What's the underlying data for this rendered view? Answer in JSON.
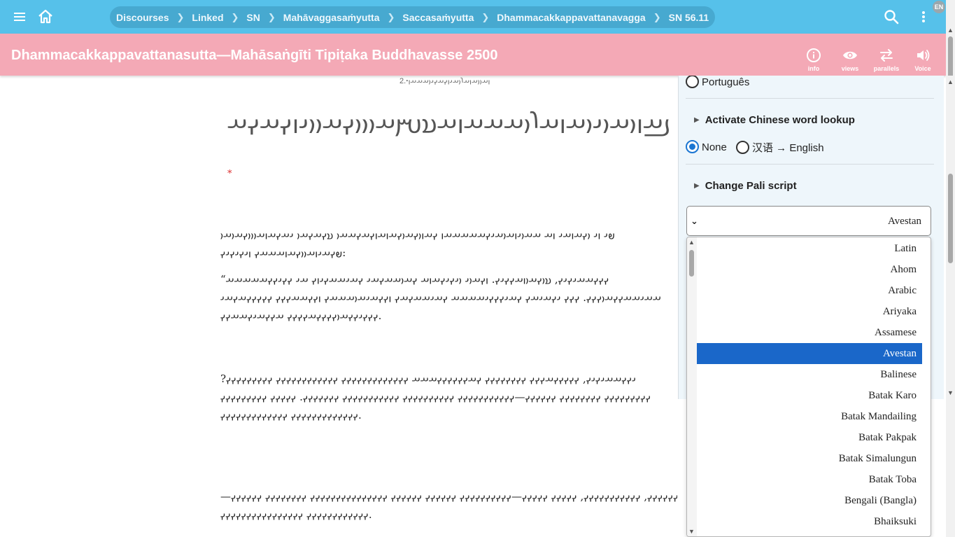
{
  "topbar": {
    "breadcrumbs": [
      "Discourses",
      "Linked",
      "SN",
      "Mahāvaggasaṁyutta",
      "Saccasaṁyutta",
      "Dhammacakkappavattanavagga",
      "SN 56.11"
    ],
    "lang_badge": "EN"
  },
  "titlebar": {
    "title": "Dhammacakkappavattanasutta—Mahāsaṅgīti Tipiṭaka Buddhavasse 2500",
    "buttons": [
      {
        "label": "info",
        "icon": "info-icon"
      },
      {
        "label": "views",
        "icon": "eye-icon"
      },
      {
        "label": "parallels",
        "icon": "parallels-icon"
      },
      {
        "label": "Voice",
        "icon": "speaker-icon"
      }
    ]
  },
  "content": {
    "top_line": "2.ꞏ𐬥𐬀𐬎𐬎𐬀𐬥𐬀𐬭𐬎𐬀𐬌𐬥𐬍𐬀𐬍𐬌𐬎𐬀𐬀𐬀𐬥",
    "heading": "𐬠𐬀𐬥𐬎𐬀𐬎𐬌𐬎𐬀𐬥𐬀𐬭𐬎𐬀𐬀𐬀𐬥𐬀𐬯𐬫𐬀𐬎𐬎𐬎𐬍𐬀𐬎𐬎𐬌𐬥𐬍𐬀𐬍𐬀",
    "heading_star": "*",
    "paragraphs": [
      "𐬞𐬌 𐬥𐬌 𐬎𐬍𐬀𐬥𐬀𐬌 𐬥𐬀 𐬀𐬀𐬎𐬌𐬥𐬀𐬎𐬀𐬌𐬍𐬀𐬀𐬀𐬀𐬀𐬥 𐬍𐬀𐬥𐬎𐬍𐬀𐬎𐬍𐬀𐬥𐬀𐬥𐬍𐬀𐬍𐬀𐬀𐬎 𐬯𐬍𐬀𐬍𐬀𐬎 𐬌𐬀𐬍𐬀𐬥𐬀𐬎𐬎𐬎𐬍𐬀𐬎𐬀𐬎 𐬞𐬍𐬀𐬌𐬥𐬀𐬎𐬎𐬍𐬀𐬥𐬀𐬀𐬀𐬍 𐬥𐬌𐬍𐬌𐬍𐬌𐬍:",
      "“𐬍𐬍𐬍𐬀𐬀𐬌𐬍𐬌𐬍, 𐬯𐬎𐬍𐬀𐬎𐬥𐬀𐬍𐬍𐬌𐬍. 𐬥𐬍𐬀𐬎𐬌 𐬎𐬌𐬍𐬌𐬍𐬀𐬥𐬀 𐬍𐬀𐬎𐬀𐬀𐬍𐬀𐬌 𐬍𐬀𐬌𐬀𐬀𐬍𐬌𐬥𐬍 𐬀𐬌 𐬍𐬍𐬌𐬍𐬍𐬀𐬀𐬀𐬀𐬀 𐬀𐬀𐬌𐬀𐬀𐬍𐬍𐬀𐬎𐬍𐬍𐬍. 𐬍𐬍𐬍 𐬌𐬍𐬀𐬌𐬀𐬍 𐬍𐬀𐬌𐬍𐬍𐬍𐬌𐬀𐬀𐬀𐬀 𐬍𐬀𐬌𐬀𐬀𐬍𐬀𐬍 𐬥𐬍𐬍𐬀𐬌𐬀𐬎𐬀𐬀𐬀𐬍 𐬥𐬍𐬍𐬀𐬀𐬍𐬍𐬍 𐬍𐬍𐬍𐬍𐬍𐬀𐬍𐬀𐬌 𐬍𐬍𐬍𐬌𐬍𐬍𐬀𐬎𐬍𐬍𐬍𐬍𐬀𐬍𐬍𐬍𐬍 𐬀𐬍𐬍𐬀𐬌𐬍𐬀𐬀𐬍𐬍.",
      "𐬌𐬍𐬍𐬀𐬀𐬌𐬍𐬌𐬍, 𐬍𐬍𐬍𐬍𐬍𐬀𐬍𐬍𐬍 𐬍𐬍𐬍𐬍𐬍𐬍𐬍𐬍 𐬍𐬀𐬍𐬍𐬍𐬍𐬍𐬍𐬀𐬀𐬀 𐬍𐬍𐬍𐬍𐬍𐬍𐬍𐬍𐬍𐬍𐬍𐬍𐬍 𐬍𐬍𐬍𐬍𐬍𐬍𐬍𐬍𐬍𐬍𐬍𐬍 𐬍𐬍𐬍𐬍𐬍𐬍𐬍𐬍𐬍? 𐬍𐬍𐬍𐬍𐬍𐬍𐬍𐬍𐬍 𐬍𐬍𐬍𐬍𐬍𐬍𐬍𐬍 𐬍𐬍𐬍𐬍𐬍𐬍—𐬍𐬍𐬍𐬍𐬍𐬍𐬍𐬍𐬍𐬍𐬍 𐬍𐬍𐬍𐬍𐬍𐬍𐬍𐬍𐬍𐬍 𐬍𐬍𐬍𐬍𐬍𐬍𐬍𐬍𐬍𐬍𐬍 𐬍𐬍𐬍𐬍𐬍𐬍𐬍. 𐬍𐬍𐬍𐬍𐬍 𐬍𐬍𐬍𐬍𐬍𐬍𐬍𐬍𐬍 𐬍𐬍𐬍𐬍𐬍𐬍𐬍𐬍𐬍𐬍𐬍𐬍𐬍 𐬍𐬍𐬍𐬍𐬍𐬍𐬍𐬍𐬍𐬍𐬍𐬍𐬍.",
      "𐬍𐬍𐬍𐬍𐬍𐬍, 𐬍𐬍𐬍𐬍𐬍𐬍𐬍𐬍𐬍𐬍𐬍, 𐬍𐬍𐬍𐬍𐬍 𐬍𐬍𐬍𐬍𐬍—𐬍𐬍𐬍𐬍𐬍𐬍𐬍𐬍𐬍𐬍 𐬍𐬍𐬍𐬍𐬍𐬍 𐬍𐬍𐬍𐬍𐬍𐬍 𐬍𐬍𐬍𐬍𐬍𐬍𐬍𐬍𐬍𐬍𐬍𐬍𐬍𐬍𐬍 𐬍𐬍𐬍𐬍𐬍𐬍𐬍𐬍 𐬍𐬍𐬍𐬍𐬍𐬍—𐬍𐬍𐬍𐬍𐬍𐬍𐬍𐬍𐬍𐬍𐬍𐬍 𐬍𐬍𐬍𐬍𐬍𐬍𐬍𐬍𐬍𐬍𐬍𐬍𐬍𐬍𐬍𐬍."
    ]
  },
  "panel": {
    "portugues_label": "Português",
    "chinese_lookup": {
      "title": "Activate Chinese word lookup",
      "options": [
        "None",
        "汉语 → English"
      ],
      "selected": "None"
    },
    "pali_script": {
      "title": "Change Pali script",
      "selected": "Avestan",
      "options": [
        "Latin",
        "Ahom",
        "Arabic",
        "Ariyaka",
        "Assamese",
        "Avestan",
        "Balinese",
        "Batak Karo",
        "Batak Mandailing",
        "Batak Pakpak",
        "Batak Simalungun",
        "Batak Toba",
        "Bengali (Bangla)",
        "Bhaiksuki"
      ]
    }
  },
  "colors": {
    "topbar": "#56c1ea",
    "breadcrumb_pill": "#47a9d0",
    "titlebar": "#f4a9b6",
    "accent": "#1b76d2",
    "selected_option": "#1a67c9"
  }
}
